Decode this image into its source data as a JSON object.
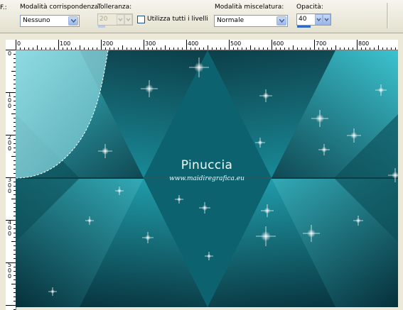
{
  "toolbar": {
    "grip_label": "F.:",
    "match_mode": {
      "label": "Modalità corrispondenza:",
      "value": "Nessuno"
    },
    "tolerance": {
      "label": "Tolleranza:",
      "value": "20"
    },
    "use_all_layers": {
      "label": "Utilizza tutti i livelli",
      "checked": false
    },
    "blend_mode": {
      "label": "Modalità miscelatura:",
      "value": "Normale"
    },
    "opacity": {
      "label": "Opacità:",
      "value": "40",
      "level": 0.4
    }
  },
  "rulers": {
    "horizontal": [
      "0",
      "100",
      "200",
      "300",
      "400",
      "500",
      "600",
      "700",
      "800"
    ],
    "vertical": [
      "0",
      "100",
      "200",
      "300",
      "400",
      "500"
    ]
  },
  "canvas": {
    "watermark_title": "Pinuccia",
    "watermark_url": "www.maidiregrafica.eu",
    "colors": {
      "dark": "#06303a",
      "mid": "#0e6e7b",
      "light": "#3cc3cf",
      "selection": "#7fd3db"
    }
  }
}
